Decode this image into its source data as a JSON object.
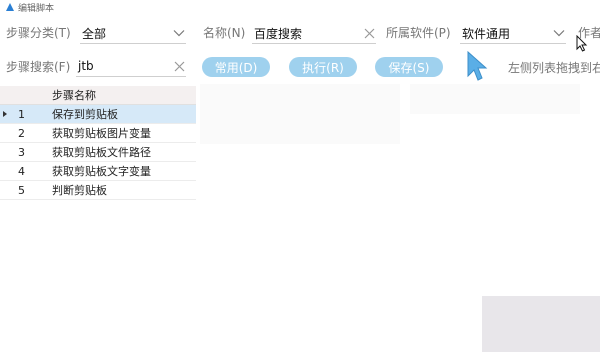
{
  "window": {
    "title": "编辑脚本"
  },
  "row1": {
    "category_label": "步骤分类(T)",
    "category_value": "全部",
    "name_label": "名称(N)",
    "name_value": "百度搜索",
    "software_label": "所属软件(P)",
    "software_value": "软件通用",
    "author_label": "作者"
  },
  "row2": {
    "search_label": "步骤搜索(F)",
    "search_value": "jtb",
    "common_button": "常用(D)",
    "execute_button": "执行(R)",
    "save_button": "保存(S)",
    "drag_hint": "左侧列表拖拽到右"
  },
  "grid": {
    "column_header": "步骤名称",
    "rows": [
      {
        "num": "1",
        "name": "保存到剪贴板",
        "selected": true
      },
      {
        "num": "2",
        "name": "获取剪贴板图片变量"
      },
      {
        "num": "3",
        "name": "获取剪贴板文件路径"
      },
      {
        "num": "4",
        "name": "获取剪贴板文字变量"
      },
      {
        "num": "5",
        "name": "判断剪贴板"
      }
    ]
  },
  "colors": {
    "accent": "#2a7fd4",
    "button_bg": "#9fd1ee",
    "selected_row": "#d6e9f8",
    "cursor": "#5aaee6"
  },
  "icons": {
    "dropdown": "chevron-down-icon",
    "clear": "clear-x-icon",
    "row_marker": "current-row-marker-icon",
    "cursor": "mouse-cursor-icon"
  }
}
